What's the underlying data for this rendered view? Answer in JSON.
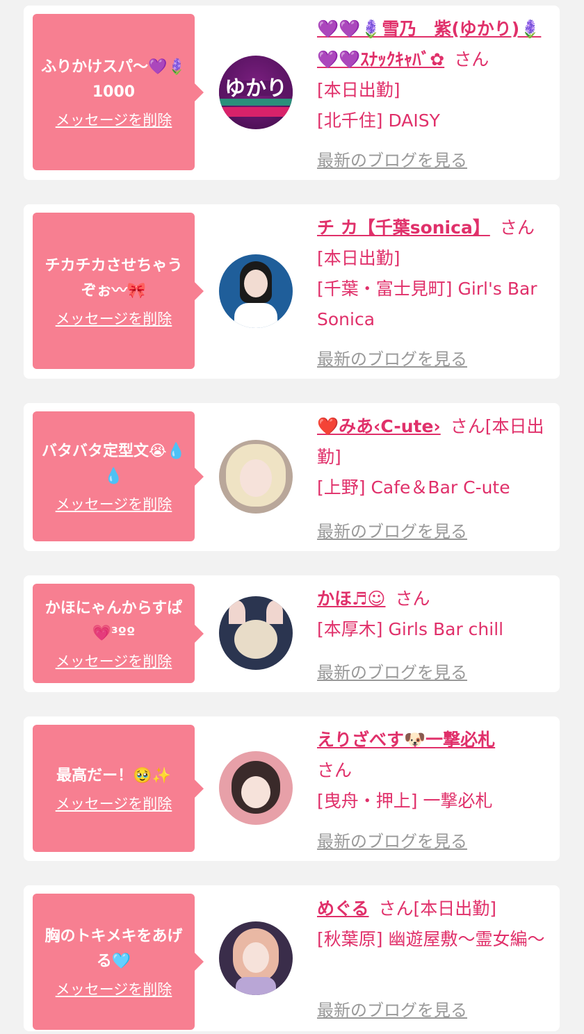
{
  "delete_label": "メッセージを削除",
  "blog_label": "最新のブログを見る",
  "san_label": "さん",
  "colors": {
    "accent": "#e0306a",
    "bubble": "#f77f91",
    "background": "#f2f2f2"
  },
  "cards": [
    {
      "message": "ふりかけスパ〜💜🪻1000",
      "name": "💜💜🪻雪乃　紫(ゆかり)🪻💜💜ｽﾅｯｸｷｬﾊﾞ✿",
      "lines": [
        "[本日出勤]",
        "[北千住] DAISY"
      ],
      "avatar_text": "ゆかり"
    },
    {
      "message": "チカチカさせちゃうぞぉ〰🎀",
      "name": "チ カ【千葉sonica】",
      "lines": [
        "[本日出勤]",
        "[千葉・富士見町] Girl's Bar Sonica"
      ]
    },
    {
      "message": "バタバタ定型文😭💧💧",
      "name": "❤️みあ‹C-ute›",
      "lines": [
        "[本日出勤]",
        "[上野] Cafe＆Bar C-ute"
      ]
    },
    {
      "message": "かほにゃんからすぱ💗³ºº",
      "name": "かほ♬☺︎",
      "lines": [
        "[本厚木] Girls Bar chill"
      ]
    },
    {
      "message": "最高だー！🥹✨",
      "name": "えりざべす🐶一撃必札",
      "lines": [
        "[曳舟・押上] 一撃必札"
      ]
    },
    {
      "message": "胸のトキメキをあげる🩵",
      "name": "めぐる",
      "lines": [
        "[本日出勤]",
        "[秋葉原] 幽遊屋敷〜霊女編〜"
      ]
    }
  ]
}
